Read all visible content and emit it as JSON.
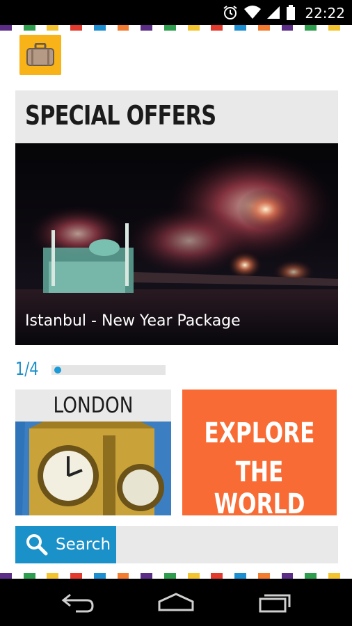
{
  "status_bar": {
    "time": "22:22",
    "icons": [
      "alarm-icon",
      "wifi-icon",
      "signal-icon",
      "battery-icon"
    ]
  },
  "colors": {
    "stripe": [
      "#5b2d86",
      "#ffffff",
      "#2e9e4e",
      "#ffffff",
      "#f4c430",
      "#ffffff",
      "#e23b2e",
      "#ffffff",
      "#1d8fd1",
      "#ffffff",
      "#f37c31",
      "#ffffff",
      "#5b2d86",
      "#ffffff",
      "#2e9e4e",
      "#ffffff",
      "#f4c430",
      "#ffffff",
      "#e23b2e",
      "#ffffff",
      "#1d8fd1",
      "#ffffff",
      "#f37c31",
      "#ffffff",
      "#5b2d86",
      "#ffffff",
      "#2e9e4e",
      "#ffffff",
      "#f4c430",
      "#ffffff"
    ],
    "accent_blue": "#1b91c9",
    "explore_orange": "#f86b34",
    "logo_yellow": "#f7b318"
  },
  "app": {
    "logo_icon": "suitcase-icon"
  },
  "special_offers": {
    "title": "SPECIAL OFFERS",
    "slide_caption": "Istanbul - New Year Package",
    "pager": {
      "label": "1/4",
      "current": 1,
      "total": 4
    }
  },
  "tiles": {
    "london_label": "LONDON",
    "explore_line1": "EXPLORE",
    "explore_line2": "THE WORLD"
  },
  "search": {
    "label": "Search",
    "icon": "search-icon"
  },
  "nav_bar": {
    "icons": [
      "back-icon",
      "home-icon",
      "recent-apps-icon"
    ]
  }
}
